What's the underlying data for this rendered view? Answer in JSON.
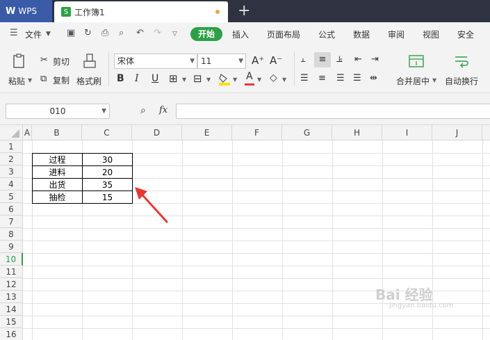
{
  "titlebar": {
    "app_label": "WPS",
    "doc_tab": "工作簿1",
    "new_tab": "+"
  },
  "menubar": {
    "file": "文件",
    "start": "开始",
    "items": [
      "插入",
      "页面布局",
      "公式",
      "数据",
      "审阅",
      "视图",
      "安全"
    ]
  },
  "ribbon": {
    "paste": "粘贴",
    "cut": "剪切",
    "copy": "复制",
    "format_painter": "格式刷",
    "font_name": "宋体",
    "font_size": "11",
    "bold": "B",
    "italic": "I",
    "underline": "U",
    "merge_center": "合并居中",
    "auto_wrap": "自动换行",
    "grow_font": "A⁺",
    "shrink_font": "A⁻",
    "font_color": "A"
  },
  "formula_bar": {
    "cell_ref": "010",
    "fx": "fx"
  },
  "grid": {
    "columns": [
      "A",
      "B",
      "C",
      "D",
      "E",
      "F",
      "G",
      "H",
      "I",
      "J"
    ],
    "rows": [
      "1",
      "2",
      "3",
      "4",
      "5",
      "6",
      "7",
      "8",
      "9",
      "10",
      "11",
      "12",
      "13",
      "14",
      "15",
      "16"
    ],
    "selected_row": "10",
    "data": [
      {
        "label": "过程",
        "value": "30"
      },
      {
        "label": "进料",
        "value": "20"
      },
      {
        "label": "出货",
        "value": "35"
      },
      {
        "label": "抽检",
        "value": "15"
      }
    ]
  },
  "watermark": {
    "brand": "Bai 经验",
    "url": "jingyan.baidu.com"
  },
  "colors": {
    "accent_green": "#2da046",
    "wps_blue": "#3a5ba8",
    "annotation_red": "#e53935"
  }
}
